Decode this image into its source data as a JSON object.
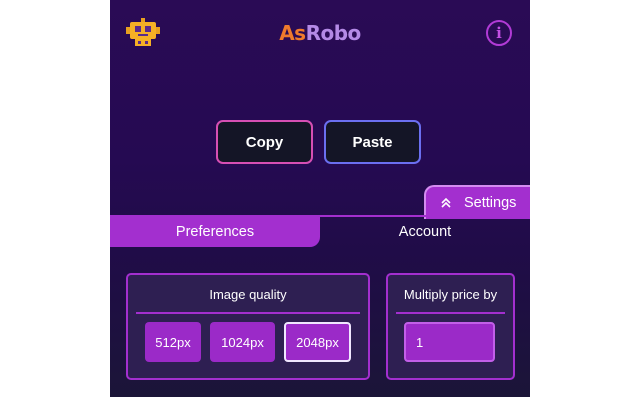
{
  "header": {
    "logo_part1": "As",
    "logo_part2": "Robo",
    "robot_icon": "robot-icon",
    "info_icon": "info-icon",
    "info_glyph": "i"
  },
  "actions": {
    "copy_label": "Copy",
    "paste_label": "Paste"
  },
  "settings": {
    "toggle_label": "Settings",
    "toggle_icon": "chevron-up-icon"
  },
  "tabs": [
    {
      "label": "Preferences",
      "active": true
    },
    {
      "label": "Account",
      "active": false
    }
  ],
  "image_quality": {
    "title": "Image quality",
    "options": [
      "512px",
      "1024px",
      "2048px"
    ],
    "selected": "2048px"
  },
  "price": {
    "title": "Multiply price by",
    "value": "1"
  },
  "colors": {
    "accent": "#a32fcf",
    "logo_orange": "#f07a2c",
    "logo_purple": "#b48ae6",
    "background": "#250a52"
  }
}
